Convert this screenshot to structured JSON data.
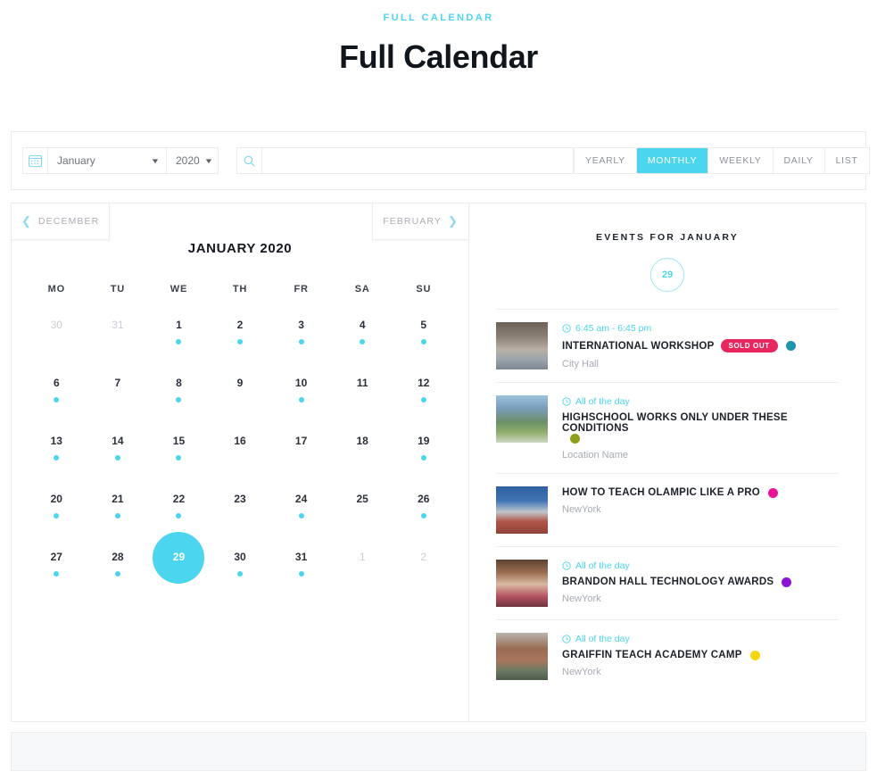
{
  "page": {
    "eyebrow": "FULL CALENDAR",
    "title": "Full Calendar"
  },
  "toolbar": {
    "calendar_icon": "calendar-icon",
    "month_select": {
      "value": "January",
      "caret": "▼"
    },
    "year_select": {
      "value": "2020",
      "caret": "▼"
    },
    "search": {
      "icon": "search-icon",
      "value": "",
      "placeholder": ""
    },
    "views": [
      {
        "label": "YEARLY",
        "active": false
      },
      {
        "label": "MONTHLY",
        "active": true
      },
      {
        "label": "WEEKLY",
        "active": false
      },
      {
        "label": "DAILY",
        "active": false
      },
      {
        "label": "LIST",
        "active": false
      }
    ]
  },
  "calendar": {
    "prev_label": "DECEMBER",
    "next_label": "FEBRUARY",
    "prev_chevron": "❮",
    "next_chevron": "❯",
    "month_title": "JANUARY 2020",
    "weekdays": [
      "MO",
      "TU",
      "WE",
      "TH",
      "FR",
      "SA",
      "SU"
    ],
    "weeks": [
      [
        {
          "day": "30",
          "muted": true,
          "dot": false,
          "selected": false
        },
        {
          "day": "31",
          "muted": true,
          "dot": false,
          "selected": false
        },
        {
          "day": "1",
          "muted": false,
          "dot": true,
          "selected": false
        },
        {
          "day": "2",
          "muted": false,
          "dot": true,
          "selected": false
        },
        {
          "day": "3",
          "muted": false,
          "dot": true,
          "selected": false
        },
        {
          "day": "4",
          "muted": false,
          "dot": true,
          "selected": false
        },
        {
          "day": "5",
          "muted": false,
          "dot": true,
          "selected": false
        }
      ],
      [
        {
          "day": "6",
          "muted": false,
          "dot": true,
          "selected": false
        },
        {
          "day": "7",
          "muted": false,
          "dot": false,
          "selected": false
        },
        {
          "day": "8",
          "muted": false,
          "dot": true,
          "selected": false
        },
        {
          "day": "9",
          "muted": false,
          "dot": false,
          "selected": false
        },
        {
          "day": "10",
          "muted": false,
          "dot": true,
          "selected": false
        },
        {
          "day": "11",
          "muted": false,
          "dot": false,
          "selected": false
        },
        {
          "day": "12",
          "muted": false,
          "dot": true,
          "selected": false
        }
      ],
      [
        {
          "day": "13",
          "muted": false,
          "dot": true,
          "selected": false
        },
        {
          "day": "14",
          "muted": false,
          "dot": true,
          "selected": false
        },
        {
          "day": "15",
          "muted": false,
          "dot": true,
          "selected": false
        },
        {
          "day": "16",
          "muted": false,
          "dot": false,
          "selected": false
        },
        {
          "day": "17",
          "muted": false,
          "dot": false,
          "selected": false
        },
        {
          "day": "18",
          "muted": false,
          "dot": false,
          "selected": false
        },
        {
          "day": "19",
          "muted": false,
          "dot": true,
          "selected": false
        }
      ],
      [
        {
          "day": "20",
          "muted": false,
          "dot": true,
          "selected": false
        },
        {
          "day": "21",
          "muted": false,
          "dot": true,
          "selected": false
        },
        {
          "day": "22",
          "muted": false,
          "dot": true,
          "selected": false
        },
        {
          "day": "23",
          "muted": false,
          "dot": false,
          "selected": false
        },
        {
          "day": "24",
          "muted": false,
          "dot": true,
          "selected": false
        },
        {
          "day": "25",
          "muted": false,
          "dot": false,
          "selected": false
        },
        {
          "day": "26",
          "muted": false,
          "dot": true,
          "selected": false
        }
      ],
      [
        {
          "day": "27",
          "muted": false,
          "dot": true,
          "selected": false
        },
        {
          "day": "28",
          "muted": false,
          "dot": true,
          "selected": false
        },
        {
          "day": "29",
          "muted": false,
          "dot": false,
          "selected": true
        },
        {
          "day": "30",
          "muted": false,
          "dot": true,
          "selected": false
        },
        {
          "day": "31",
          "muted": false,
          "dot": true,
          "selected": false
        },
        {
          "day": "1",
          "muted": true,
          "dot": false,
          "selected": false
        },
        {
          "day": "2",
          "muted": true,
          "dot": false,
          "selected": false
        }
      ]
    ]
  },
  "events_panel": {
    "heading": "EVENTS FOR JANUARY",
    "day_badge": "29",
    "events": [
      {
        "time": "6:45 am - 6:45 pm",
        "has_time": true,
        "title": "INTERNATIONAL WORKSHOP",
        "badge": "SOLD OUT",
        "dot_color": "#1d95a8",
        "location": "City Hall",
        "thumb": "street-scene-thumbnail"
      },
      {
        "time": "All of the day",
        "has_time": true,
        "title": "HIGHSCHOOL WORKS ONLY UNDER THESE CONDITIONS",
        "badge": "",
        "dot_color": "#8f9f18",
        "location": "Location Name",
        "thumb": "park-trees-thumbnail"
      },
      {
        "time": "",
        "has_time": false,
        "title": "HOW TO TEACH OLAMPIC LIKE A PRO",
        "badge": "",
        "dot_color": "#ec1296",
        "location": "NewYork",
        "thumb": "track-hurdles-thumbnail"
      },
      {
        "time": "All of the day",
        "has_time": true,
        "title": "BRANDON HALL TECHNOLOGY AWARDS",
        "badge": "",
        "dot_color": "#8c14d6",
        "location": "NewYork",
        "thumb": "students-lab-thumbnail"
      },
      {
        "time": "All of the day",
        "has_time": true,
        "title": "GRAIFFIN TEACH ACADEMY CAMP",
        "badge": "",
        "dot_color": "#f5d512",
        "location": "NewYork",
        "thumb": "campus-steps-thumbnail"
      }
    ]
  },
  "colors": {
    "accent": "#4cd5ee",
    "badge": "#e8275f",
    "muted_text": "#c9ced4"
  }
}
